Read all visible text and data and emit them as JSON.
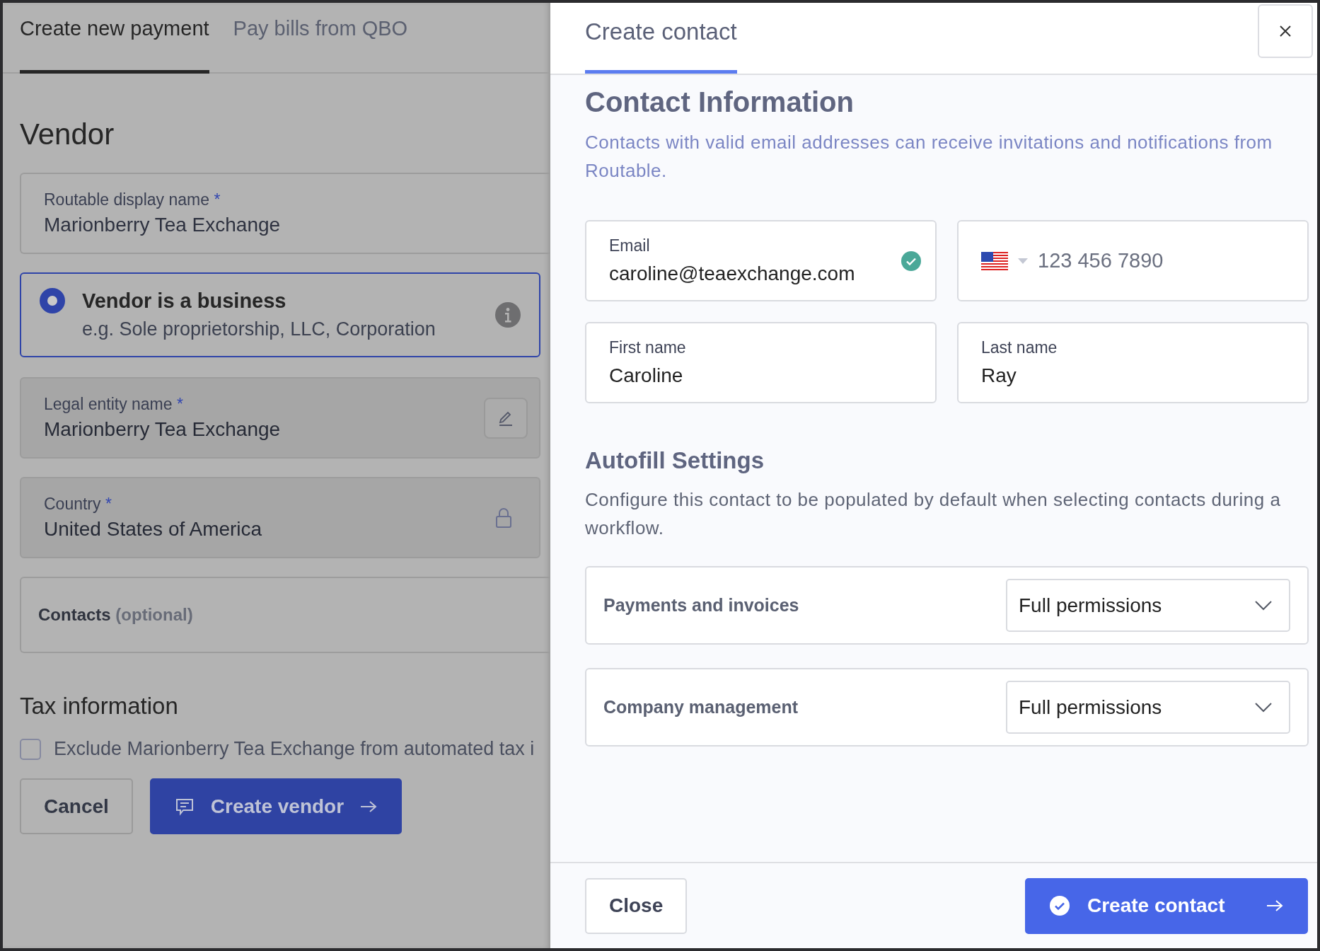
{
  "background_page": {
    "tabs": [
      {
        "label": "Create new payment",
        "selected": true
      },
      {
        "label": "Pay bills from QBO",
        "selected": false
      }
    ],
    "heading": "Vendor",
    "fields": [
      {
        "kind": "text",
        "label": "Routable display name",
        "required_mark": "*",
        "value": "Marionberry Tea Exchange",
        "disabled": false
      },
      {
        "kind": "radio",
        "title": "Vendor is a business",
        "subtitle": "e.g. Sole proprietorship, LLC, Corporation",
        "selected": true
      },
      {
        "kind": "editable",
        "label": "Legal entity name",
        "required_mark": "*",
        "value": "Marionberry Tea Exchange",
        "disabled": true
      },
      {
        "kind": "locked",
        "label": "Country",
        "required_mark": "*",
        "value": "United States of America",
        "disabled": true
      },
      {
        "kind": "contacts",
        "label": "Contacts",
        "hint": "(optional)"
      }
    ],
    "tax_heading": "Tax information",
    "tax_checkbox": {
      "label": "Exclude Marionberry Tea Exchange from automated tax i",
      "checked": false
    },
    "buttons": [
      {
        "kind": "secondary",
        "label": "Cancel"
      },
      {
        "kind": "primary",
        "label": "Create vendor"
      }
    ]
  },
  "panel": {
    "tab": {
      "label": "Create contact",
      "selected": true
    },
    "heading": "Contact Information",
    "description": "Contacts with valid email addresses can receive invitations and notifications from Routable.",
    "fields": [
      {
        "kind": "email",
        "label": "Email",
        "value": "caroline@teaexchange.com",
        "valid": true
      },
      {
        "kind": "phone",
        "placeholder": "123 456 7890"
      },
      {
        "kind": "text",
        "label": "First name",
        "value": "Caroline"
      },
      {
        "kind": "text",
        "label": "Last name",
        "value": "Ray"
      }
    ],
    "autofill_heading": "Autofill Settings",
    "autofill_description": "Configure this contact to be populated by default when selecting contacts during a workflow.",
    "settings": [
      {
        "label": "Payments and invoices",
        "value": "Full permissions"
      },
      {
        "label": "Company management",
        "value": "Full permissions"
      }
    ],
    "buttons": [
      {
        "kind": "secondary",
        "label": "Close"
      },
      {
        "kind": "primary",
        "label": "Create contact"
      }
    ]
  }
}
